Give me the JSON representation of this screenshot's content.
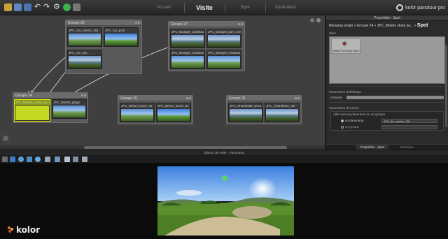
{
  "toolbar": {
    "tabs": [
      {
        "label": "Accueil",
        "active": false
      },
      {
        "label": "Visite",
        "active": true
      },
      {
        "label": "Style",
        "active": false
      },
      {
        "label": "Générateur",
        "active": false
      }
    ],
    "brand": "kolor panotour pro",
    "icons": [
      "folder-open-icon",
      "save-icon",
      "save-as-icon",
      "undo-icon",
      "redo-icon",
      "settings-icon",
      "play-icon",
      "stop-icon"
    ]
  },
  "graph": {
    "groups": [
      {
        "title": "Groupe 22",
        "nodes": [
          "JPC_Aix_casino_151",
          "JPC_Aix_pont",
          "JPC_Aix_pla..."
        ]
      },
      {
        "title": "Groupe 27",
        "nodes": [
          "JPC_Bourget_Chateau",
          "JPC_Bourget_port_172",
          "JPC_Bourget_Chateau",
          "JPC_Bourget_Chateau"
        ]
      },
      {
        "title": "Groupe 24",
        "nodes": [
          "JPC_Motets_skate_pa...",
          "JPC_Motets_plage"
        ]
      },
      {
        "title": "Groupe 29",
        "nodes": [
          "JPC_Brison_lavoir_01",
          "JPC_Brison_lavoir_02"
        ]
      },
      {
        "title": "Groupe 31",
        "nodes": [
          "JPC_Chambotte_terra...",
          "JPC_Chambotte_toit"
        ]
      }
    ]
  },
  "props": {
    "title": "Propriétés - Spot",
    "breadcrumb": "Nouveau projet » Groupe 24 » JPC_Motets skate pa... »",
    "breadcrumb_current": "Spot",
    "style_label": "Style",
    "style_item": "Default Point Spot Style 1",
    "display_label": "Paramètres d'affichage",
    "tooltip_label": "Infobulle",
    "actions_label": "Paramètres d'Actions",
    "actions_desc": "Aller vers un panorama ou un groupe",
    "radio_panorama": "un panorama",
    "radio_group": "un groupe",
    "panorama_value": "JPC_Aix_casino_151",
    "tabs": [
      "Propriétés - Spot",
      "Historique"
    ]
  },
  "editor": {
    "title": "Éditeur de visite - Panorama",
    "tool_icons": [
      "select-icon",
      "hand-icon",
      "add-spot-icon",
      "polygon-icon",
      "zoom-in-icon",
      "zoom-out-icon",
      "fit-icon",
      "delete-icon",
      "grid-icon",
      "camera-icon"
    ]
  },
  "viewer": {
    "logo": "kolor"
  }
}
